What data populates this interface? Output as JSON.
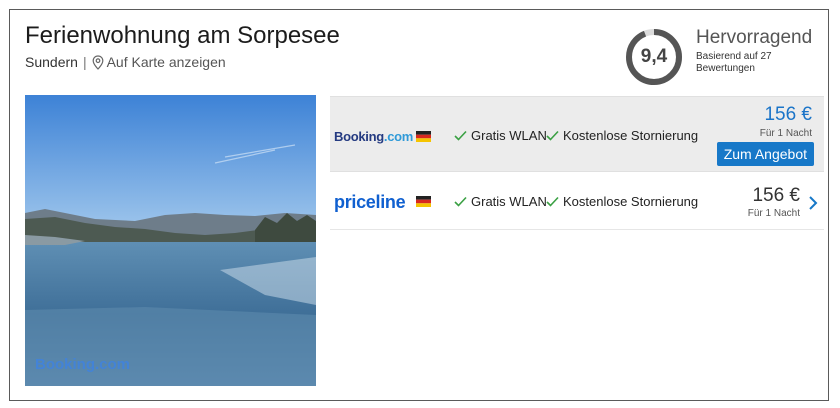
{
  "hotel": {
    "title": "Ferienwohnung am Sorpesee",
    "city": "Sundern",
    "separator": "|",
    "map_link": "Auf Karte anzeigen"
  },
  "rating": {
    "score": "9,4",
    "score_fraction": 0.94,
    "label": "Hervorragend",
    "note": "Basierend auf 27 Bewertungen",
    "ring_color": "#555555"
  },
  "photo": {
    "watermark": "Booking.com"
  },
  "offers": [
    {
      "provider": "Booking.com",
      "logo_main": "Booking",
      "logo_suffix": ".com",
      "flag": "germany-flag",
      "features": [
        "Gratis WLAN",
        "Kostenlose Stornierung"
      ],
      "price": "156 €",
      "price_note": "Für 1 Nacht",
      "cta_label": "Zum Angebot",
      "price_color": "#1a74c8"
    },
    {
      "provider": "priceline",
      "logo_main": "priceline",
      "flag": "germany-flag",
      "features": [
        "Gratis WLAN",
        "Kostenlose Stornierung"
      ],
      "price": "156 €",
      "price_note": "Für 1 Nacht",
      "price_color": "#333333"
    }
  ],
  "colors": {
    "accent": "#1778c8",
    "check": "#3aa043",
    "highlight_row": "#ececec"
  }
}
